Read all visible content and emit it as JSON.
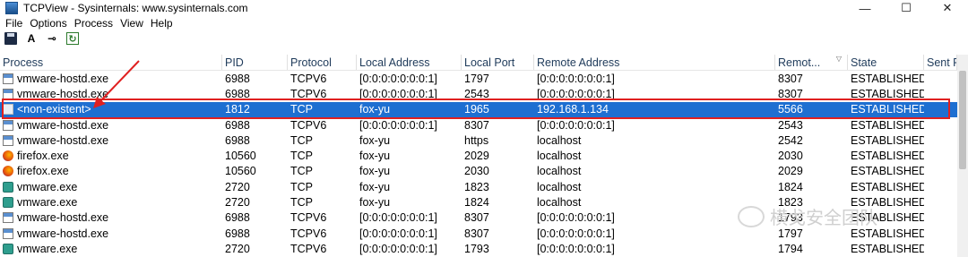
{
  "window": {
    "title": "TCPView - Sysinternals: www.sysinternals.com",
    "minimize": "—",
    "maximize": "☐",
    "close": "✕"
  },
  "menu": [
    "File",
    "Options",
    "Process",
    "View",
    "Help"
  ],
  "toolbar": {
    "autofont": "A",
    "connect": "⊸",
    "refresh": "↻"
  },
  "columns": [
    "Process",
    "PID",
    "Protocol",
    "Local Address",
    "Local Port",
    "Remote Address",
    "Remot...",
    "State",
    "Sent P"
  ],
  "rows": [
    {
      "icon": "vmhost",
      "process": "vmware-hostd.exe",
      "pid": "6988",
      "proto": "TCPV6",
      "local": "[0:0:0:0:0:0:0:1]",
      "lport": "1797",
      "remote": "[0:0:0:0:0:0:0:1]",
      "rport": "8307",
      "state": "ESTABLISHED"
    },
    {
      "icon": "vmhost",
      "process": "vmware-hostd.exe",
      "pid": "6988",
      "proto": "TCPV6",
      "local": "[0:0:0:0:0:0:0:1]",
      "lport": "2543",
      "remote": "[0:0:0:0:0:0:0:1]",
      "rport": "8307",
      "state": "ESTABLISHED"
    },
    {
      "icon": "none",
      "process": "<non-existent>",
      "pid": "1812",
      "proto": "TCP",
      "local": "fox-yu",
      "lport": "1965",
      "remote": "192.168.1.134",
      "rport": "5566",
      "state": "ESTABLISHED",
      "selected": true
    },
    {
      "icon": "vmhost",
      "process": "vmware-hostd.exe",
      "pid": "6988",
      "proto": "TCPV6",
      "local": "[0:0:0:0:0:0:0:1]",
      "lport": "8307",
      "remote": "[0:0:0:0:0:0:0:1]",
      "rport": "2543",
      "state": "ESTABLISHED"
    },
    {
      "icon": "vmhost",
      "process": "vmware-hostd.exe",
      "pid": "6988",
      "proto": "TCP",
      "local": "fox-yu",
      "lport": "https",
      "remote": "localhost",
      "rport": "2542",
      "state": "ESTABLISHED"
    },
    {
      "icon": "firefox",
      "process": "firefox.exe",
      "pid": "10560",
      "proto": "TCP",
      "local": "fox-yu",
      "lport": "2029",
      "remote": "localhost",
      "rport": "2030",
      "state": "ESTABLISHED"
    },
    {
      "icon": "firefox",
      "process": "firefox.exe",
      "pid": "10560",
      "proto": "TCP",
      "local": "fox-yu",
      "lport": "2030",
      "remote": "localhost",
      "rport": "2029",
      "state": "ESTABLISHED"
    },
    {
      "icon": "vmware",
      "process": "vmware.exe",
      "pid": "2720",
      "proto": "TCP",
      "local": "fox-yu",
      "lport": "1823",
      "remote": "localhost",
      "rport": "1824",
      "state": "ESTABLISHED"
    },
    {
      "icon": "vmware",
      "process": "vmware.exe",
      "pid": "2720",
      "proto": "TCP",
      "local": "fox-yu",
      "lport": "1824",
      "remote": "localhost",
      "rport": "1823",
      "state": "ESTABLISHED"
    },
    {
      "icon": "vmhost",
      "process": "vmware-hostd.exe",
      "pid": "6988",
      "proto": "TCPV6",
      "local": "[0:0:0:0:0:0:0:1]",
      "lport": "8307",
      "remote": "[0:0:0:0:0:0:0:1]",
      "rport": "1793",
      "state": "ESTABLISHED"
    },
    {
      "icon": "vmhost",
      "process": "vmware-hostd.exe",
      "pid": "6988",
      "proto": "TCPV6",
      "local": "[0:0:0:0:0:0:0:1]",
      "lport": "8307",
      "remote": "[0:0:0:0:0:0:0:1]",
      "rport": "1797",
      "state": "ESTABLISHED"
    },
    {
      "icon": "vmware",
      "process": "vmware.exe",
      "pid": "2720",
      "proto": "TCPV6",
      "local": "[0:0:0:0:0:0:0:1]",
      "lport": "1793",
      "remote": "[0:0:0:0:0:0:0:1]",
      "rport": "1794",
      "state": "ESTABLISHED"
    }
  ],
  "colors": {
    "selection": "#1e6fd1",
    "highlight_box": "#e02020"
  },
  "watermark": "横戈安全团队"
}
